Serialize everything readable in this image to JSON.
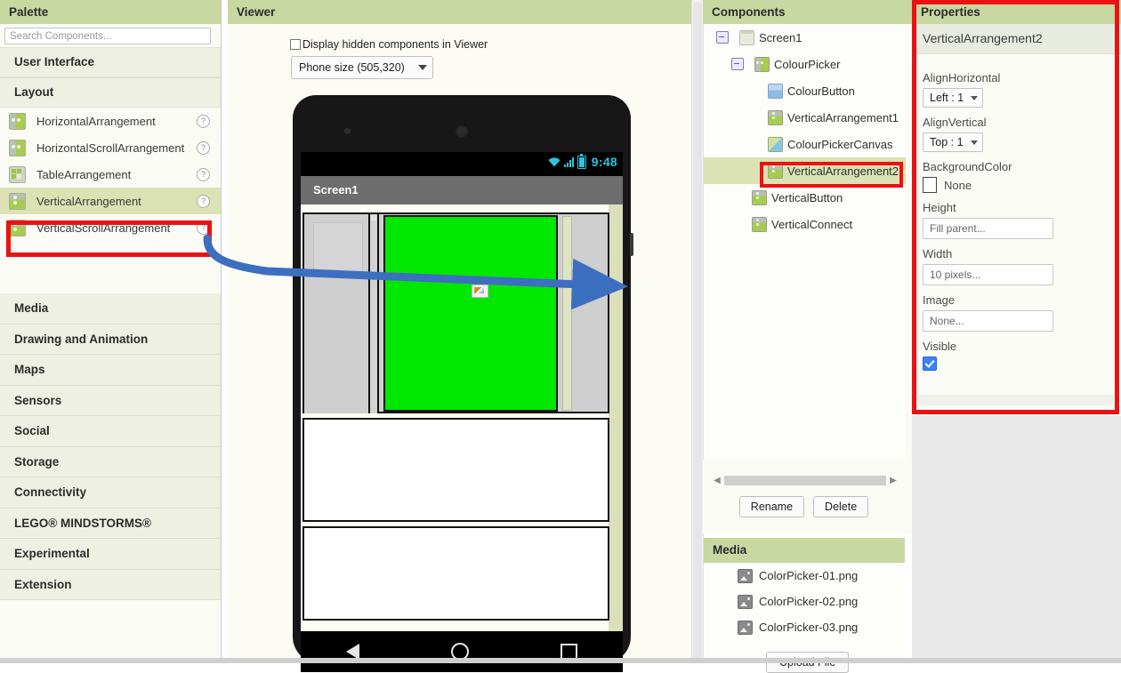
{
  "palette": {
    "title": "Palette",
    "search_placeholder": "Search Components...",
    "categories_top": [
      "User Interface",
      "Layout"
    ],
    "layout_items": [
      {
        "label": "HorizontalArrangement",
        "icon": "horizontal-arrangement-icon",
        "help": "?"
      },
      {
        "label": "HorizontalScrollArrangement",
        "icon": "horizontal-scroll-arrangement-icon",
        "help": "?"
      },
      {
        "label": "TableArrangement",
        "icon": "table-arrangement-icon",
        "help": "?"
      },
      {
        "label": "VerticalArrangement",
        "icon": "vertical-arrangement-icon",
        "help": "?"
      },
      {
        "label": "VerticalScrollArrangement",
        "icon": "vertical-scroll-arrangement-icon",
        "help": "?"
      }
    ],
    "categories_bottom": [
      "Media",
      "Drawing and Animation",
      "Maps",
      "Sensors",
      "Social",
      "Storage",
      "Connectivity",
      "LEGO® MINDSTORMS®",
      "Experimental",
      "Extension"
    ],
    "highlight_color": "#ee1111"
  },
  "viewer": {
    "title": "Viewer",
    "hidden_components_label": "Display hidden components in Viewer",
    "hidden_components_checked": false,
    "size_select_value": "Phone size (505,320)",
    "phone": {
      "status_time": "9:48",
      "screen_title": "Screen1",
      "canvas_color": "#00e800",
      "nav_back": "back-triangle",
      "nav_home": "home-circle",
      "nav_recent": "recent-square"
    }
  },
  "components": {
    "title": "Components",
    "tree": [
      {
        "label": "Screen1",
        "depth": 0,
        "icon": "screen-icon",
        "toggle": true,
        "selected": false
      },
      {
        "label": "ColourPicker",
        "depth": 1,
        "icon": "horizontal-arrangement-icon",
        "toggle": true,
        "selected": false
      },
      {
        "label": "ColourButton",
        "depth": 2,
        "icon": "button-icon",
        "toggle": false,
        "selected": false
      },
      {
        "label": "VerticalArrangement1",
        "depth": 2,
        "icon": "vertical-arrangement-icon",
        "toggle": false,
        "selected": false
      },
      {
        "label": "ColourPickerCanvas",
        "depth": 2,
        "icon": "canvas-icon",
        "toggle": false,
        "selected": false
      },
      {
        "label": "VerticalArrangement2",
        "depth": 2,
        "icon": "vertical-arrangement-icon",
        "toggle": false,
        "selected": true
      },
      {
        "label": "VerticalButton",
        "depth": 1,
        "icon": "vertical-arrangement-icon",
        "toggle": false,
        "selected": false
      },
      {
        "label": "VerticalConnect",
        "depth": 1,
        "icon": "vertical-arrangement-icon",
        "toggle": false,
        "selected": false
      }
    ],
    "rename_label": "Rename",
    "delete_label": "Delete",
    "scroll_left_icon": "◀",
    "scroll_right_icon": "▶"
  },
  "media": {
    "title": "Media",
    "files": [
      "ColorPicker-01.png",
      "ColorPicker-02.png",
      "ColorPicker-03.png"
    ],
    "upload_label": "Upload File"
  },
  "properties": {
    "title": "Properties",
    "component_name": "VerticalArrangement2",
    "fields": [
      {
        "label": "AlignHorizontal",
        "type": "select",
        "value": "Left : 1"
      },
      {
        "label": "AlignVertical",
        "type": "select",
        "value": "Top : 1"
      },
      {
        "label": "BackgroundColor",
        "type": "color",
        "value": "None"
      },
      {
        "label": "Height",
        "type": "text",
        "value": "Fill parent..."
      },
      {
        "label": "Width",
        "type": "text",
        "value": "10 pixels..."
      },
      {
        "label": "Image",
        "type": "text",
        "value": "None..."
      },
      {
        "label": "Visible",
        "type": "checkbox",
        "value": "checked"
      }
    ],
    "highlight_color": "#ee1111"
  },
  "annotation": {
    "arrow_color": "#3d6fc0",
    "arrow_description": "drag arrow from VerticalArrangement palette item to viewer"
  }
}
